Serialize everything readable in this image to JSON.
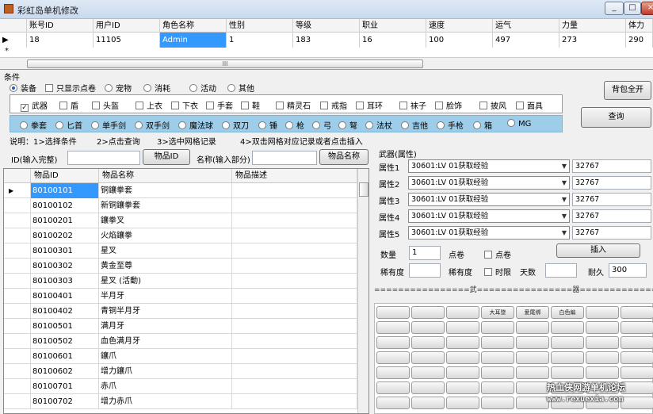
{
  "window": {
    "title": "彩虹岛单机修改",
    "controls": [
      "_",
      "□",
      "×"
    ]
  },
  "top_grid": {
    "headers": [
      "账号ID",
      "用户ID",
      "角色名称",
      "性别",
      "等级",
      "职业",
      "速度",
      "运气",
      "力量",
      "体力"
    ],
    "row": [
      "18",
      "11105",
      "Admin",
      "1",
      "183",
      "16",
      "100",
      "497",
      "273",
      "290"
    ],
    "new_row_marker": "*",
    "scroll_thumb": "III"
  },
  "conditions": {
    "label": "条件",
    "radios": [
      "装备",
      "只显示点卷",
      "宠物",
      "消耗",
      "活动",
      "其他"
    ],
    "selected_radio": "装备",
    "equip_checks": [
      "武器",
      "盾",
      "头盔",
      "上衣",
      "下衣",
      "手套",
      "鞋",
      "精灵石",
      "戒指",
      "耳环",
      "袜子",
      "脸饰",
      "披风",
      "面具"
    ],
    "checked": [
      "武器"
    ],
    "weapon_radios": [
      "拳套",
      "匕首",
      "单手剑",
      "双手剑",
      "魔法球",
      "双刀",
      "锤",
      "枪",
      "弓",
      "弩",
      "法杖",
      "吉他",
      "手枪",
      "箱",
      "MG"
    ]
  },
  "buttons": {
    "bag_open": "背包全开",
    "query": "查询",
    "item_id": "物品ID",
    "item_name": "物品名称",
    "insert": "插入"
  },
  "instructions": {
    "label": "说明：",
    "steps": [
      "1>选择条件",
      "2>点击查询",
      "3>选中网格记录",
      "4>双击网格对应记录或者点击插入"
    ]
  },
  "search": {
    "id_label": "ID(输入完整)",
    "id_value": "",
    "name_label": "名称(输入部分)",
    "name_value": ""
  },
  "item_grid": {
    "headers": [
      "物品ID",
      "物品名称",
      "物品描述"
    ],
    "rows": [
      [
        "80100101",
        "铜鑲拳套",
        ""
      ],
      [
        "80100102",
        "新铜鑲拳套",
        ""
      ],
      [
        "80100201",
        "鑲拳叉",
        ""
      ],
      [
        "80100202",
        "火焰鑲拳",
        ""
      ],
      [
        "80100301",
        "星叉",
        ""
      ],
      [
        "80100302",
        "黄金至尊",
        ""
      ],
      [
        "80100303",
        "星叉 (活動)",
        ""
      ],
      [
        "80100401",
        "半月牙",
        ""
      ],
      [
        "80100402",
        "青铜半月牙",
        ""
      ],
      [
        "80100501",
        "满月牙",
        ""
      ],
      [
        "80100502",
        "血色满月牙",
        ""
      ],
      [
        "80100601",
        "鑲爪",
        ""
      ],
      [
        "80100602",
        "增力鑲爪",
        ""
      ],
      [
        "80100701",
        "赤爪",
        ""
      ],
      [
        "80100702",
        "增力赤爪",
        ""
      ]
    ]
  },
  "weapon_props": {
    "title": "武器(属性)",
    "attrs": [
      {
        "label": "属性1",
        "select": "30601:LV 01获取经验",
        "value": "32767"
      },
      {
        "label": "属性2",
        "select": "30601:LV 01获取经验",
        "value": "32767"
      },
      {
        "label": "属性3",
        "select": "30601:LV 01获取经验",
        "value": "32767"
      },
      {
        "label": "属性4",
        "select": "30601:LV 01获取经验",
        "value": "32767"
      },
      {
        "label": "属性5",
        "select": "30601:LV 01获取经验",
        "value": "32767"
      }
    ],
    "quantity_label": "数量",
    "quantity": "1",
    "point_label": "点卷",
    "point_check": "点卷",
    "rarity_label": "稀有度",
    "rarity_value": "",
    "rarity_label2": "稀有度",
    "rarity_value2": "",
    "time_limit": "时限",
    "days_label": "天数",
    "days_value": "",
    "durability_label": "耐久",
    "durability_value": "300"
  },
  "weapon_bar": "================武================器================栏================",
  "slots": [
    "",
    "",
    "",
    "大耳墜",
    "爱尾绑",
    "白色編",
    "",
    "",
    "",
    "",
    "",
    "",
    "",
    "",
    "",
    "",
    "",
    "",
    "",
    "",
    "",
    "",
    "",
    "",
    "",
    "",
    "",
    "",
    "",
    "",
    "",
    "",
    "",
    "",
    "",
    "",
    "",
    "",
    "",
    "",
    "",
    "",
    "",
    "",
    "",
    "",
    "",
    "",
    "",
    "",
    "",
    "",
    "",
    "",
    "",
    "",
    "",
    "",
    "",
    "",
    "",
    "",
    ""
  ],
  "watermark": {
    "line1": "热血侠网游单机论坛",
    "line2": "www.rexuexia.com"
  }
}
